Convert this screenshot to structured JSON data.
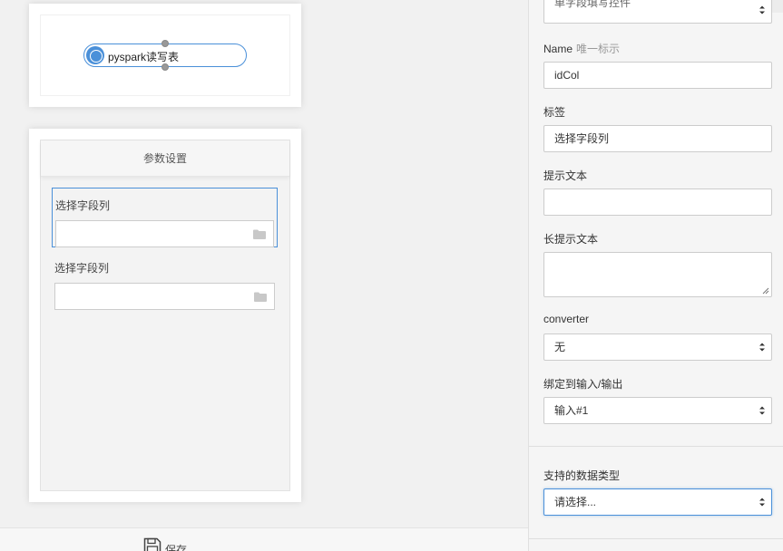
{
  "canvas": {
    "node": {
      "label": "pyspark读写表"
    }
  },
  "params": {
    "header": "参数设置",
    "fields": [
      {
        "label": "选择字段列",
        "value": ""
      },
      {
        "label": "选择字段列",
        "value": ""
      }
    ]
  },
  "footer": {
    "save_label": "保存"
  },
  "props": {
    "widget_type_clipped": "单字段填写控件",
    "name_label": "Name",
    "name_hint": "唯一标示",
    "name_value": "idCol",
    "tag_label": "标签",
    "tag_value": "选择字段列",
    "hint_label": "提示文本",
    "hint_value": "",
    "long_hint_label": "长提示文本",
    "long_hint_value": "",
    "converter_label": "converter",
    "converter_value": "无",
    "bind_label": "绑定到输入/输出",
    "bind_value": "输入#1",
    "datatype_label": "支持的数据类型",
    "datatype_value": "请选择..."
  },
  "colors": {
    "accent": "#4a90d9",
    "panel_bg": "#f5f5f5"
  }
}
